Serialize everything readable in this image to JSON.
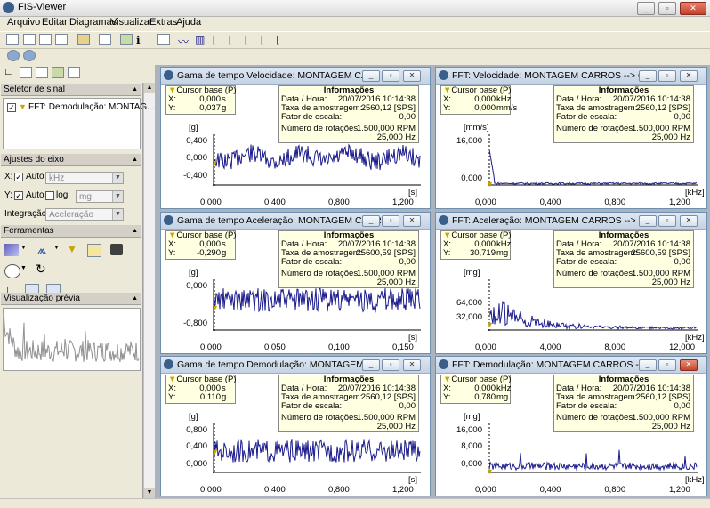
{
  "app": {
    "title": "FIS-Viewer"
  },
  "menu": [
    "Arquivo",
    "Editar",
    "Diagramas",
    "Visualizar",
    "Extras",
    "Ajuda"
  ],
  "left": {
    "signal_selector": {
      "header": "Seletor de sinal",
      "item": "FFT: Demodulação: MONTAG..."
    },
    "axis": {
      "header": "Ajustes do eixo",
      "x_label": "X:",
      "x_auto": "Auto",
      "x_unit": "kHz",
      "y_label": "Y:",
      "y_auto": "Auto",
      "y_log": "log",
      "y_unit": "mg",
      "integration_label": "Integração:",
      "integration_value": "Aceleração"
    },
    "tools": {
      "header": "Ferramentas"
    },
    "preview": {
      "header": "Visualização prévia"
    }
  },
  "windows": [
    {
      "title": "Gama de tempo Velocidade: MONTAGEM CA...",
      "cursor": {
        "title": "Cursor base (P)",
        "x_label": "X:",
        "x_value": "0,000",
        "x_unit": "s",
        "y_label": "Y:",
        "y_value": "0,037",
        "y_unit": "g"
      },
      "yunit": "[g]",
      "xunit": "[s]",
      "yticks": [
        "0,400",
        "0,000",
        "-0,400"
      ],
      "xticks": [
        "0,000",
        "0,400",
        "0,800",
        "1,200"
      ]
    },
    {
      "title": "FFT: Velocidade: MONTAGEM CARROS --> CR...",
      "cursor": {
        "title": "Cursor base (P)",
        "x_label": "X:",
        "x_value": "0,000",
        "x_unit": "kHz",
        "y_label": "Y:",
        "y_value": "0,000",
        "y_unit": "mm/s"
      },
      "yunit": "[mm/s]",
      "xunit": "[kHz]",
      "yticks": [
        "16,000",
        "0,000"
      ],
      "xticks": [
        "0,000",
        "0,400",
        "0,800",
        "1,200"
      ]
    },
    {
      "title": "Gama de tempo Aceleração: MONTAGEM CARR...",
      "cursor": {
        "title": "Cursor base (P)",
        "x_label": "X:",
        "x_value": "0,000",
        "x_unit": "s",
        "y_label": "Y:",
        "y_value": "-0,290",
        "y_unit": "g"
      },
      "yunit": "[g]",
      "xunit": "[s]",
      "yticks": [
        "0,000",
        "-0,800"
      ],
      "xticks": [
        "0,000",
        "0,050",
        "0,100",
        "0,150"
      ]
    },
    {
      "title": "FFT: Aceleração: MONTAGEM CARROS --> CR...",
      "cursor": {
        "title": "Cursor base (P)",
        "x_label": "X:",
        "x_value": "0,000",
        "x_unit": "kHz",
        "y_label": "Y:",
        "y_value": "30,719",
        "y_unit": "mg"
      },
      "yunit": "[mg]",
      "xunit": "[kHz]",
      "yticks": [
        "64,000",
        "32,000"
      ],
      "xticks": [
        "0,000",
        "4,000",
        "8,000",
        "12,000"
      ]
    },
    {
      "title": "Gama de tempo Demodulação: MONTAGEM ...",
      "cursor": {
        "title": "Cursor base (P)",
        "x_label": "X:",
        "x_value": "0,000",
        "x_unit": "s",
        "y_label": "Y:",
        "y_value": "0,110",
        "y_unit": "g"
      },
      "yunit": "[g]",
      "xunit": "[s]",
      "yticks": [
        "0,800",
        "0,400",
        "0,000"
      ],
      "xticks": [
        "0,000",
        "0,400",
        "0,800",
        "1,200"
      ]
    },
    {
      "title": "FFT: Demodulação: MONTAGEM CARROS --> ...",
      "cursor": {
        "title": "Cursor base (P)",
        "x_label": "X:",
        "x_value": "0,000",
        "x_unit": "kHz",
        "y_label": "Y:",
        "y_value": "0,780",
        "y_unit": "mg"
      },
      "yunit": "[mg]",
      "xunit": "[kHz]",
      "yticks": [
        "16,000",
        "8,000",
        "0,000"
      ],
      "xticks": [
        "0,000",
        "0,400",
        "0,800",
        "1,200"
      ]
    }
  ],
  "info": {
    "title": "Informações",
    "date_label": "Data / Hora:",
    "date_value": "20/07/2016 10:14:38",
    "rate_label": "Taxa de amostragem:",
    "rate_values": [
      "2560,12 [SPS]",
      "2560,12 [SPS]",
      "25600,59 [SPS]",
      "25600,59 [SPS]",
      "2560,12 [SPS]",
      "2560,12 [SPS]"
    ],
    "scale_label": "Fator de escala:",
    "scale_value": "0,00",
    "rot_label": "Número de rotações:",
    "rot_value": "1.500,000 RPM",
    "rot_hz": "25,000 Hz"
  },
  "colors": {
    "trace": "#1a1a8c",
    "cursor_box": "#ffffe1",
    "caption": "#c4d2e3"
  }
}
